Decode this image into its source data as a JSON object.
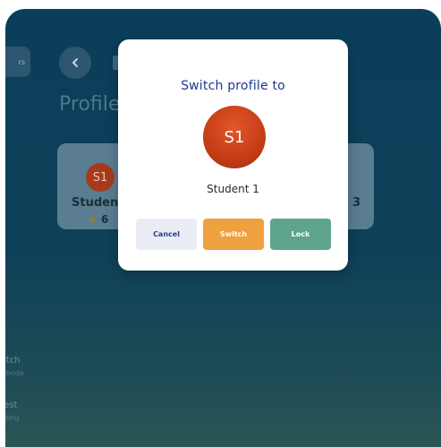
{
  "background": {
    "left_pill_label": "rs",
    "page_title": "Profile",
    "cards": [
      {
        "avatar": "S1",
        "name": "Student",
        "stars": "6"
      },
      {
        "name": "3"
      }
    ],
    "side_items": [
      {
        "title": "itch",
        "subtitle": "mode"
      },
      {
        "title": "est",
        "subtitle": "ding"
      }
    ]
  },
  "modal": {
    "title": "Switch profile to",
    "avatar": "S1",
    "name": "Student 1",
    "buttons": {
      "cancel": "Cancel",
      "switch": "Switch",
      "lock": "Lock"
    }
  },
  "colors": {
    "accent_blue": "#1d3a8f",
    "switch_orange": "#efa13f",
    "lock_green": "#5ea48a",
    "avatar_red": "#c53d16"
  }
}
